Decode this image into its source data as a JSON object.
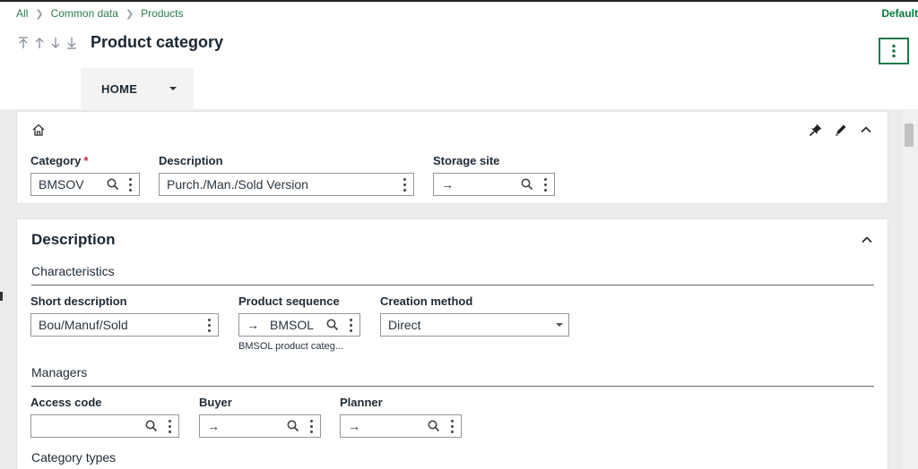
{
  "breadcrumb": {
    "all": "All",
    "common_data": "Common data",
    "products": "Products"
  },
  "header": {
    "default_label": "Default",
    "title": "Product category"
  },
  "nav_arrows": [
    "first-icon",
    "up-icon",
    "down-icon",
    "last-icon"
  ],
  "tabs": {
    "home": "HOME"
  },
  "header_card": {
    "category": {
      "label": "Category",
      "required_mark": "*",
      "value": "BMSOV"
    },
    "description": {
      "label": "Description",
      "value": "Purch./Man./Sold Version"
    },
    "storage_site": {
      "label": "Storage site",
      "value": "→"
    }
  },
  "description_section": {
    "title": "Description",
    "characteristics": {
      "heading": "Characteristics",
      "short_description": {
        "label": "Short description",
        "value": "Bou/Manuf/Sold"
      },
      "product_sequence": {
        "label": "Product sequence",
        "value": "BMSOL",
        "hint": "BMSOL product categ..."
      },
      "creation_method": {
        "label": "Creation method",
        "value": "Direct"
      }
    },
    "managers": {
      "heading": "Managers",
      "access_code": {
        "label": "Access code",
        "value": ""
      },
      "buyer": {
        "label": "Buyer",
        "value": "→"
      },
      "planner": {
        "label": "Planner",
        "value": "→"
      }
    },
    "category_types": {
      "heading": "Category types"
    }
  },
  "colors": {
    "accent": "#1f7a4a",
    "breadcrumb": "#2a7a4b",
    "required": "#c7262c"
  }
}
